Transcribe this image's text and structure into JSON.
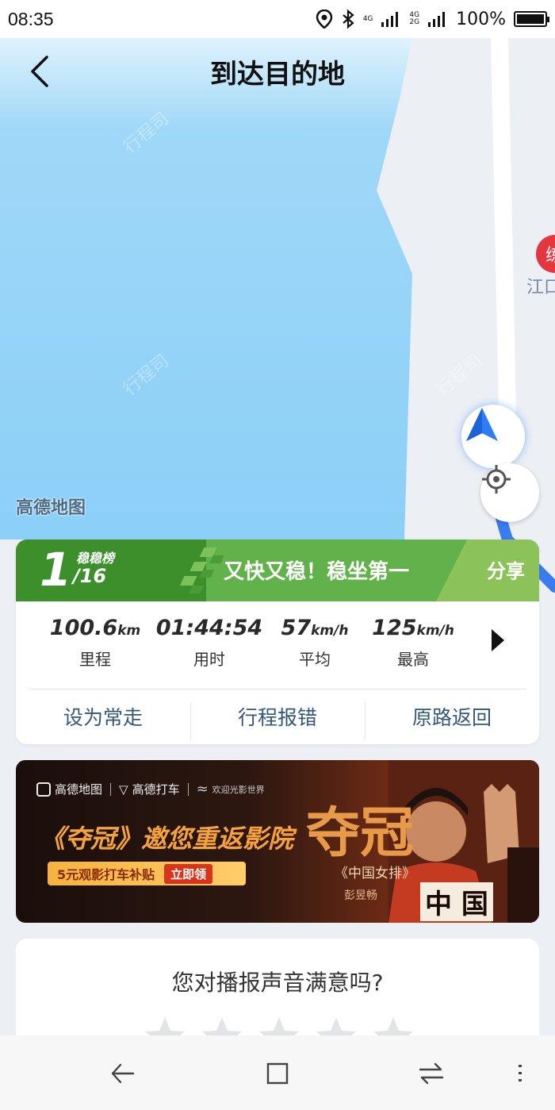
{
  "status_bar": {
    "time": "08:35",
    "network_1": "4G",
    "network_2": "4G",
    "network_3": "2G",
    "battery": "100%"
  },
  "header": {
    "title": "到达目的地"
  },
  "map": {
    "logo": "高德地图",
    "watermark": "行程司",
    "poi_badge": "练",
    "poi_label": "江口"
  },
  "trip_card": {
    "rank": "1",
    "rank_board": "稳稳榜",
    "rank_total": "/16",
    "slogan": "又快又稳！稳坐第一",
    "share_label": "分享",
    "stats": [
      {
        "value": "100.6",
        "unit": "km",
        "label": "里程"
      },
      {
        "value": "01:44:54",
        "unit": "",
        "label": "用时"
      },
      {
        "value": "57",
        "unit": "km/h",
        "label": "平均"
      },
      {
        "value": "125",
        "unit": "km/h",
        "label": "最高"
      }
    ],
    "actions": [
      "设为常走",
      "行程报错",
      "原路返回"
    ]
  },
  "ad": {
    "logo_1": "高德地图",
    "logo_2": "高德打车",
    "logo_3": "欢迎光影世界",
    "headline": "《夺冠》邀您重返影院",
    "offer": "5元观影打车补贴",
    "cta": "立即领",
    "movie_title": "夺冠",
    "movie_subtitle": "《中国女排》",
    "director": "彭昱畅",
    "jersey_text": "中 国"
  },
  "survey": {
    "question": "您对播报声音满意吗?",
    "star_count": 5
  },
  "colors": {
    "accent_green": "#62b24b",
    "dark_green": "#3d8f2c",
    "link_blue": "#34577a",
    "water_blue": "#8fd0f7",
    "nav_blue": "#2f7df6"
  }
}
